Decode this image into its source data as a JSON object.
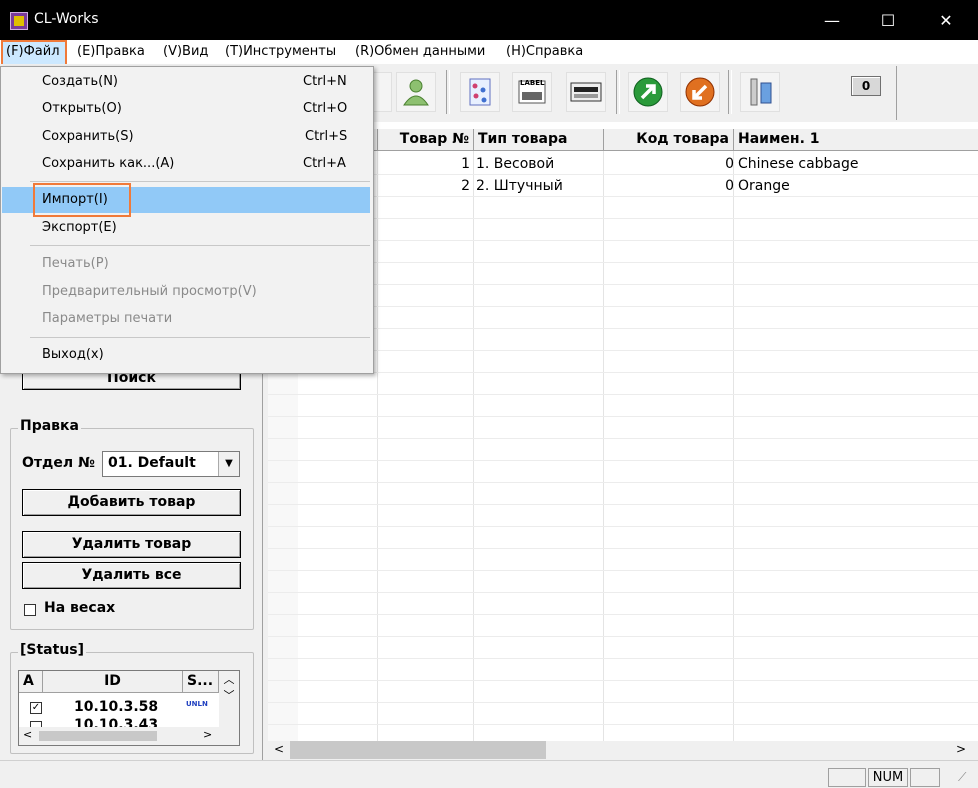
{
  "window": {
    "title": "CL-Works",
    "controls": {
      "minimize": "—",
      "maximize": "☐",
      "close": "✕"
    }
  },
  "menubar": {
    "items": [
      "(F)Файл",
      "(E)Правка",
      "(V)Вид",
      "(T)Инструменты",
      "(R)Обмен данными",
      "(H)Справка"
    ]
  },
  "file_menu": {
    "new": {
      "label": "Создать(N)",
      "shortcut": "Ctrl+N"
    },
    "open": {
      "label": "Открыть(O)",
      "shortcut": "Ctrl+O"
    },
    "save": {
      "label": "Сохранить(S)",
      "shortcut": "Ctrl+S"
    },
    "save_as": {
      "label": "Сохранить как...(A)",
      "shortcut": "Ctrl+A"
    },
    "import": {
      "label": "Импорт(I)"
    },
    "export": {
      "label": "Экспорт(E)"
    },
    "print": {
      "label": "Печать(P)"
    },
    "preview": {
      "label": "Предварительный просмотр(V)"
    },
    "print_settings": {
      "label": "Параметры печати"
    },
    "exit": {
      "label": "Выход(x)"
    }
  },
  "toolbar": {
    "counter": "0",
    "label_icon_text": "LABEL",
    "icons": [
      "user-icon",
      "plu-list-icon",
      "label-icon",
      "scale-display-icon",
      "upload-icon",
      "download-icon",
      "settings-tools-icon"
    ]
  },
  "left_panel": {
    "search_button": "Поиск",
    "edit_group": {
      "title": "Правка",
      "dept_label": "Отдел №",
      "dept_value": "01. Default",
      "add_button": "Добавить товар",
      "delete_button": "Удалить товар",
      "delete_all_button": "Удалить все",
      "on_scale_label": "На весах"
    },
    "status_group": {
      "title": "[Status]",
      "columns": [
        "A",
        "ID",
        "S..."
      ],
      "rows": [
        {
          "checked": true,
          "id": "10.10.3.58",
          "status": "UNLN"
        },
        {
          "checked": false,
          "id": "10.10.3.43",
          "status": ""
        }
      ]
    }
  },
  "grid": {
    "columns": [
      "Товар №",
      "Тип товара",
      "Код товара",
      "Наимен. 1"
    ],
    "rows": [
      {
        "no": "1",
        "type": "1. Весовой",
        "code": "0",
        "name": "Chinese cabbage"
      },
      {
        "no": "2",
        "type": "2. Штучный",
        "code": "0",
        "name": "Orange"
      }
    ]
  },
  "statusbar": {
    "num": "NUM"
  },
  "colors": {
    "highlight": "#91c9f7",
    "annotation": "#f07a3a",
    "titlebar": "#000000"
  }
}
